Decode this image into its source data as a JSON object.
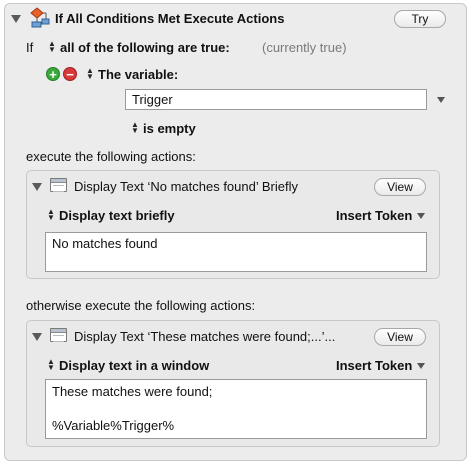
{
  "header": {
    "title": "If All Conditions Met Execute Actions",
    "try_label": "Try"
  },
  "condition": {
    "if_label": "If",
    "selector_label": "all of the following are true:",
    "status_text": "(currently true)",
    "variable_label": "The variable:",
    "variable_value": "Trigger",
    "operator_label": "is empty"
  },
  "then_section": {
    "label": "execute the following actions:",
    "action_title": "Display Text ‘No matches found’ Briefly",
    "view_label": "View",
    "mode_label": "Display text briefly",
    "insert_token_label": "Insert Token",
    "text_lines": [
      "No matches found"
    ]
  },
  "else_section": {
    "label": "otherwise execute the following actions:",
    "action_title": "Display Text ‘These matches were found;...’...",
    "view_label": "View",
    "mode_label": "Display text in a window",
    "insert_token_label": "Insert Token",
    "text_lines": [
      "These matches were found;",
      "",
      "%Variable%Trigger%"
    ]
  },
  "icons": {
    "action_icon": "if-then-flowchart-icon",
    "add_icon": "add-condition-icon",
    "remove_icon": "remove-condition-icon",
    "window_icon": "display-text-window-icon"
  },
  "colors": {
    "add": "#3aa83a",
    "remove": "#d63a3a",
    "panel_bg": "#ececec"
  }
}
